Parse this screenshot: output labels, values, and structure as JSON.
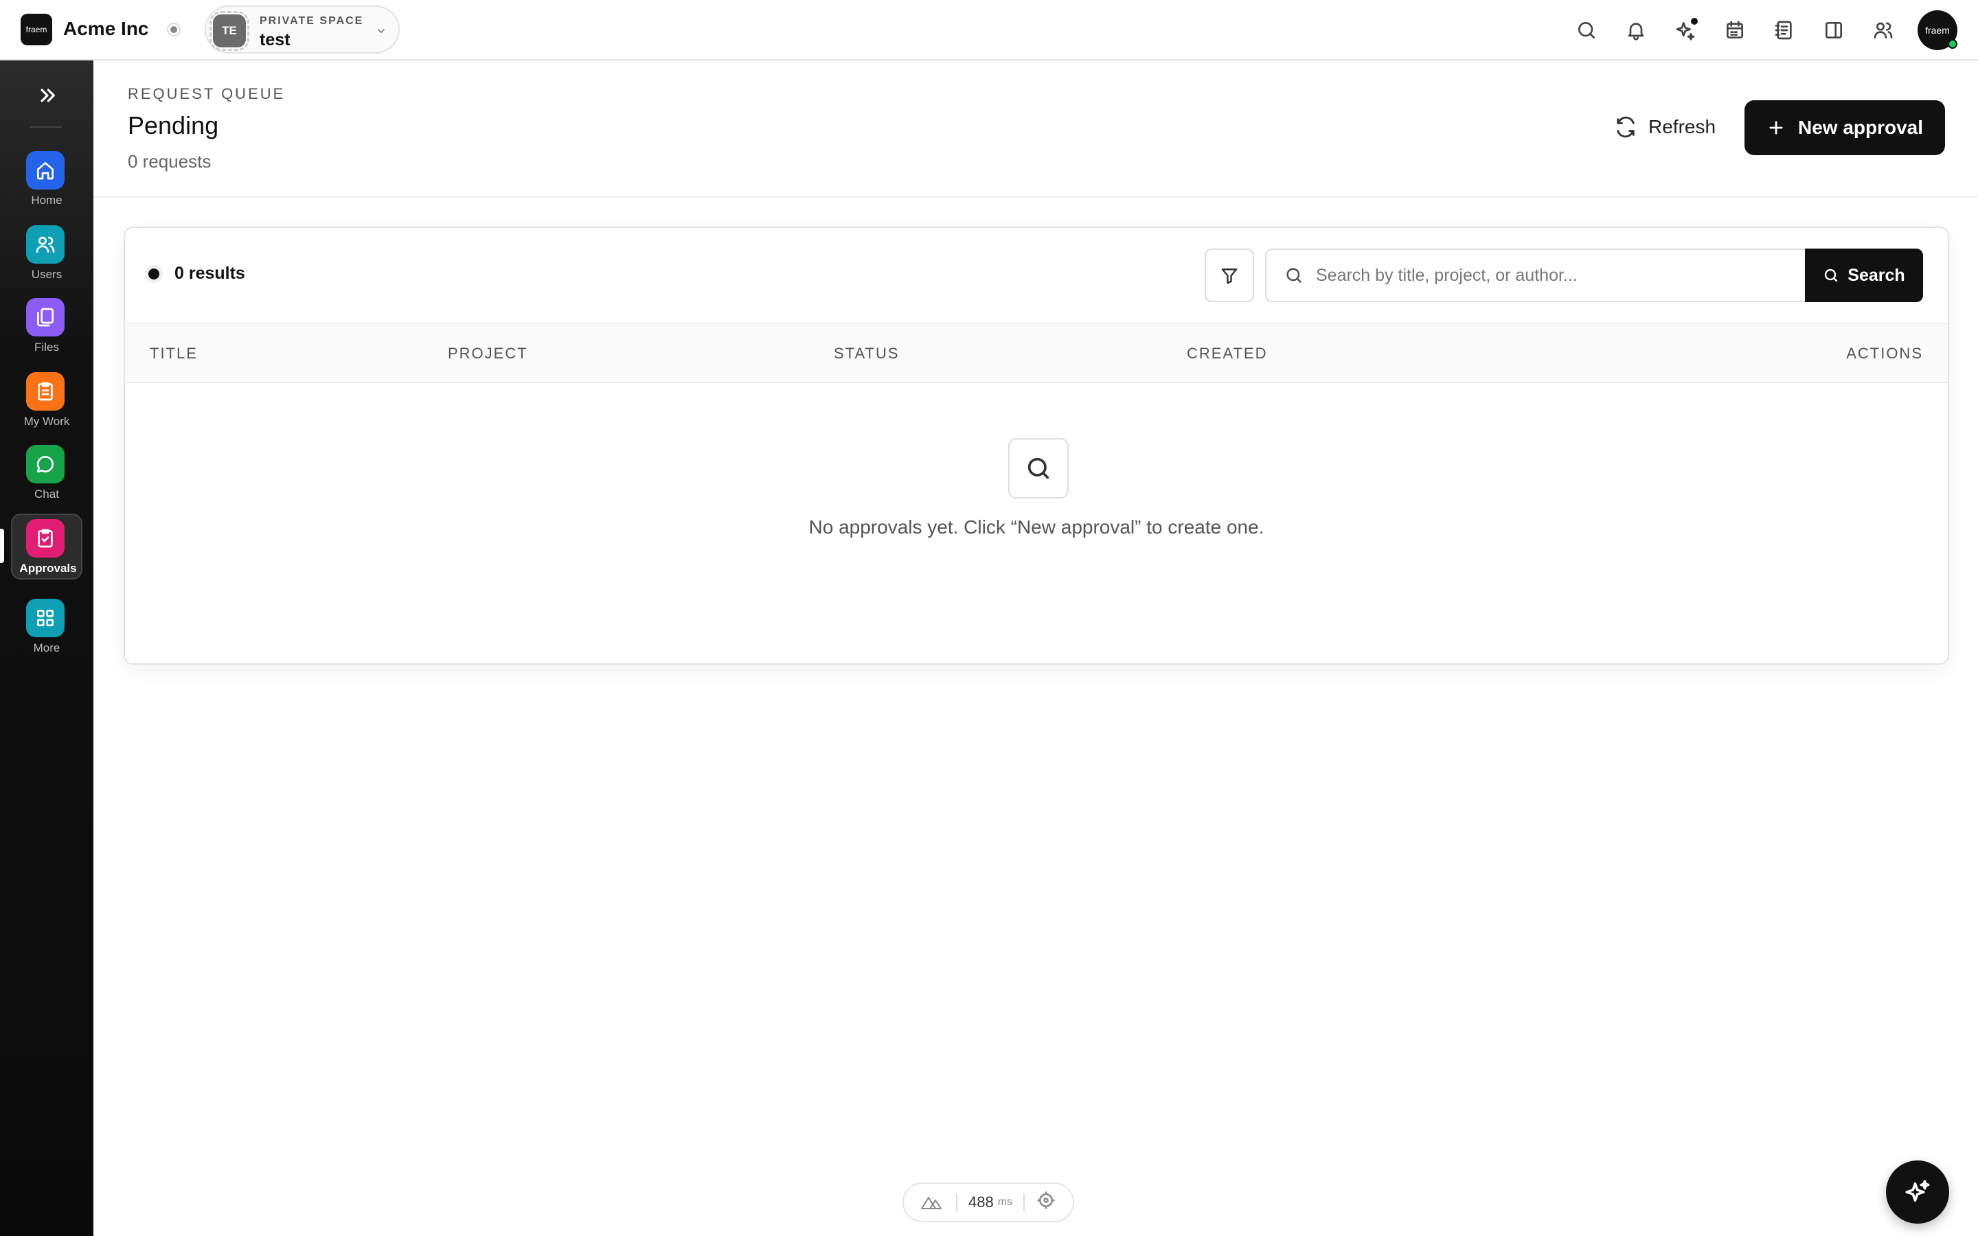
{
  "topbar": {
    "logo_text": "fraem",
    "org_name": "Acme Inc",
    "space": {
      "label": "PRIVATE SPACE",
      "name": "test",
      "initials": "TE"
    },
    "icons": [
      "search-icon",
      "bell-icon",
      "sparkles-icon",
      "calendar-icon",
      "notebook-icon",
      "panel-icon",
      "people-icon"
    ],
    "user_avatar_text": "fraem"
  },
  "sidebar": {
    "items": [
      {
        "label": "Home",
        "icon": "home-icon",
        "color": "#2563eb"
      },
      {
        "label": "Users",
        "icon": "users-icon",
        "color": "#0e9fb5"
      },
      {
        "label": "Files",
        "icon": "files-icon",
        "color": "#8b5cf6"
      },
      {
        "label": "My Work",
        "icon": "clipboard-icon",
        "color": "#f97316"
      },
      {
        "label": "Chat",
        "icon": "chat-icon",
        "color": "#16a34a"
      },
      {
        "label": "Approvals",
        "icon": "approval-icon",
        "color": "#e11d74",
        "active": true
      },
      {
        "label": "More",
        "icon": "grid-icon",
        "color": "#0e9fb5"
      }
    ]
  },
  "header": {
    "eyebrow": "REQUEST QUEUE",
    "title": "Pending",
    "count": "0 requests",
    "refresh_label": "Refresh",
    "new_label": "New approval"
  },
  "toolbar": {
    "results": "0 results",
    "search_placeholder": "Search by title, project, or author...",
    "search_value": "",
    "search_button": "Search"
  },
  "table": {
    "columns": [
      "TITLE",
      "PROJECT",
      "STATUS",
      "CREATED",
      "ACTIONS"
    ],
    "rows": [],
    "empty_message": "No approvals yet. Click “New approval” to create one."
  },
  "footer": {
    "perf_value": "488",
    "perf_unit": "ms"
  },
  "colors": {
    "accent": "#111111",
    "sidebar_bg": "#0a0a0a"
  }
}
